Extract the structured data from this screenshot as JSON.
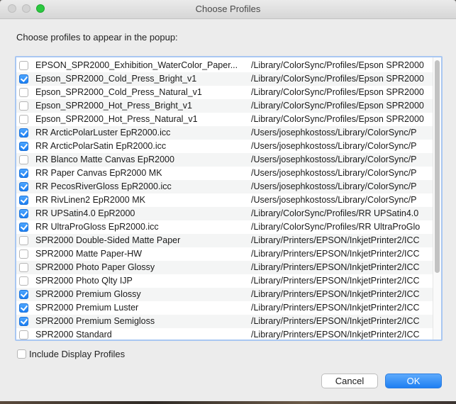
{
  "window": {
    "title": "Choose Profiles"
  },
  "prompt": "Choose profiles to appear in the popup:",
  "profiles": [
    {
      "name": "EPSON_SPR2000_Exhibition_WaterColor_Paper...",
      "path": "/Library/ColorSync/Profiles/Epson SPR2000",
      "checked": false
    },
    {
      "name": "Epson_SPR2000_Cold_Press_Bright_v1",
      "path": "/Library/ColorSync/Profiles/Epson SPR2000",
      "checked": true
    },
    {
      "name": "Epson_SPR2000_Cold_Press_Natural_v1",
      "path": "/Library/ColorSync/Profiles/Epson SPR2000",
      "checked": false
    },
    {
      "name": "Epson_SPR2000_Hot_Press_Bright_v1",
      "path": "/Library/ColorSync/Profiles/Epson SPR2000",
      "checked": false
    },
    {
      "name": "Epson_SPR2000_Hot_Press_Natural_v1",
      "path": "/Library/ColorSync/Profiles/Epson SPR2000",
      "checked": false
    },
    {
      "name": "RR ArcticPolarLuster EpR2000.icc",
      "path": "/Users/josephkostoss/Library/ColorSync/P",
      "checked": true
    },
    {
      "name": "RR ArcticPolarSatin EpR2000.icc",
      "path": "/Users/josephkostoss/Library/ColorSync/P",
      "checked": true
    },
    {
      "name": "RR Blanco Matte Canvas EpR2000",
      "path": "/Users/josephkostoss/Library/ColorSync/P",
      "checked": false
    },
    {
      "name": "RR Paper Canvas EpR2000 MK",
      "path": "/Users/josephkostoss/Library/ColorSync/P",
      "checked": true
    },
    {
      "name": "RR PecosRiverGloss EpR2000.icc",
      "path": "/Users/josephkostoss/Library/ColorSync/P",
      "checked": true
    },
    {
      "name": "RR RivLinen2 EpR2000 MK",
      "path": "/Users/josephkostoss/Library/ColorSync/P",
      "checked": true
    },
    {
      "name": "RR UPSatin4.0 EpR2000",
      "path": "/Library/ColorSync/Profiles/RR UPSatin4.0",
      "checked": true
    },
    {
      "name": "RR UltraProGloss EpR2000.icc",
      "path": "/Library/ColorSync/Profiles/RR UltraProGlo",
      "checked": true
    },
    {
      "name": "SPR2000 Double-Sided Matte Paper",
      "path": "/Library/Printers/EPSON/InkjetPrinter2/ICC",
      "checked": false
    },
    {
      "name": "SPR2000 Matte Paper-HW",
      "path": "/Library/Printers/EPSON/InkjetPrinter2/ICC",
      "checked": false
    },
    {
      "name": "SPR2000 Photo Paper Glossy",
      "path": "/Library/Printers/EPSON/InkjetPrinter2/ICC",
      "checked": false
    },
    {
      "name": "SPR2000 Photo Qlty IJP",
      "path": "/Library/Printers/EPSON/InkjetPrinter2/ICC",
      "checked": false
    },
    {
      "name": "SPR2000 Premium Glossy",
      "path": "/Library/Printers/EPSON/InkjetPrinter2/ICC",
      "checked": true
    },
    {
      "name": "SPR2000 Premium Luster",
      "path": "/Library/Printers/EPSON/InkjetPrinter2/ICC",
      "checked": true
    },
    {
      "name": "SPR2000 Premium Semigloss",
      "path": "/Library/Printers/EPSON/InkjetPrinter2/ICC",
      "checked": true
    },
    {
      "name": "SPR2000 Standard",
      "path": "/Library/Printers/EPSON/InkjetPrinter2/ICC",
      "checked": false
    }
  ],
  "include_display": {
    "label": "Include Display Profiles",
    "checked": false
  },
  "buttons": {
    "cancel": "Cancel",
    "ok": "OK"
  },
  "colors": {
    "accent": "#1b7ef2",
    "focus_ring": "#a9c7f2",
    "window_bg": "#ececec"
  }
}
